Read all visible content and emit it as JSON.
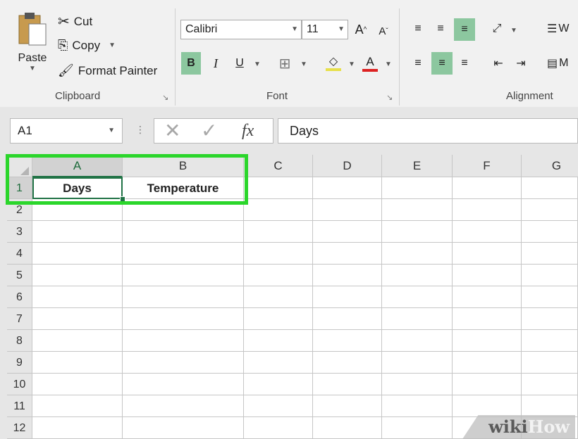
{
  "ribbon": {
    "clipboard": {
      "paste_label": "Paste",
      "cut_label": "Cut",
      "copy_label": "Copy",
      "format_painter_label": "Format Painter",
      "group_label": "Clipboard"
    },
    "font": {
      "font_name": "Calibri",
      "font_size": "11",
      "grow_label": "A",
      "shrink_label": "A",
      "bold_label": "B",
      "italic_label": "I",
      "underline_label": "U",
      "font_color_label": "A",
      "group_label": "Font"
    },
    "alignment": {
      "group_label": "Alignment",
      "wrap_partial": "W",
      "merge_partial": "M"
    }
  },
  "formula_bar": {
    "name_box": "A1",
    "fx_label": "fx",
    "content": "Days"
  },
  "sheet": {
    "columns": [
      "A",
      "B",
      "C",
      "D",
      "E",
      "F",
      "G"
    ],
    "rows": [
      "1",
      "2",
      "3",
      "4",
      "5",
      "6",
      "7",
      "8",
      "9",
      "10",
      "11",
      "12"
    ],
    "cells": {
      "A1": "Days",
      "B1": "Temperature"
    }
  },
  "watermark": {
    "part1": "wiki",
    "part2": "How"
  },
  "colors": {
    "accent": "#217346",
    "highlight": "#2bd62b",
    "active_button": "#8cc79f"
  }
}
